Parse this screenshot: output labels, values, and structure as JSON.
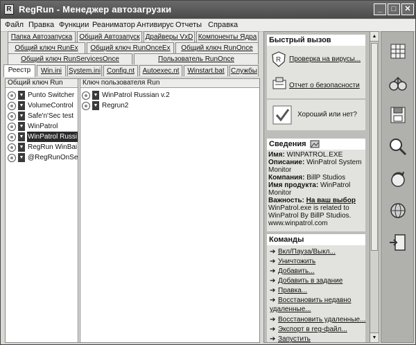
{
  "window": {
    "title": "RegRun - Менеджер автозагрузки"
  },
  "menu": [
    "Файл",
    "Правка",
    "Функции",
    "Реаниматор",
    "Антивирус",
    "Отчеты",
    "Справка"
  ],
  "tabs_row1": [
    "Папка Автозапуска",
    "Общий Автозапуск",
    "Драйверы VxD",
    "Компоненты Ядра"
  ],
  "tabs_row2": [
    "Общий ключ RunEx",
    "Общий ключ RunOnceEx",
    "Общий ключ RunOnce"
  ],
  "tabs_row3": [
    "Общий ключ RunServicesOnce",
    "Пользователь RunOnce"
  ],
  "tabs_row4": [
    "Реестр",
    "Win.ini",
    "System.ini",
    "Config.nt",
    "Autoexec.nt",
    "Winstart.bat",
    "Службы"
  ],
  "columns": {
    "left": "Общий ключ Run",
    "right": "Ключ пользователя Run"
  },
  "left_items": [
    "Punto Switcher",
    "VolumeControl",
    "Safe'n'Sec test",
    "WinPatrol",
    "WinPatrol Russi",
    "RegRun WinBai",
    "@RegRunOnSe"
  ],
  "selected_left": "WinPatrol Russi",
  "right_items": [
    "WinPatrol Russian v.2",
    "Regrun2"
  ],
  "quick": {
    "header": "Быстрый вызов",
    "check_virus": "Проверка на вирусы...",
    "security_report": "Отчет о безопасности",
    "good_or_not": "Хороший или нет?"
  },
  "info": {
    "header": "Сведения",
    "name_label": "Имя:",
    "name_value": "WINPATROL.EXE",
    "desc_label": "Описание:",
    "desc_value": "WinPatrol System Monitor",
    "company_label": "Компания:",
    "company_value": "BillP Studios",
    "product_label": "Имя продукта:",
    "product_value": "WinPatrol Monitor",
    "importance_label": "Важность:",
    "importance_value": "На ваш выбор",
    "note": "WinPatrol.exe is related to WinPatrol By BillP Studios.",
    "url": "www.winpatrol.com"
  },
  "commands": {
    "header": "Команды",
    "items": [
      "Вкл/Пауза/Выкл...",
      "Уничтожить",
      "Добавить...",
      "Добавить в задание",
      "Правка...",
      "Восстановить недавно удаленные...",
      "Восстановить удаленные...",
      "Экспорт в reg-файл...",
      "Запустить"
    ]
  },
  "toolbar_icons": [
    "grid-icon",
    "glasses-icon",
    "floppy-save-icon",
    "magnifier-icon",
    "refresh-icon",
    "globe-icon",
    "exit-door-icon"
  ]
}
